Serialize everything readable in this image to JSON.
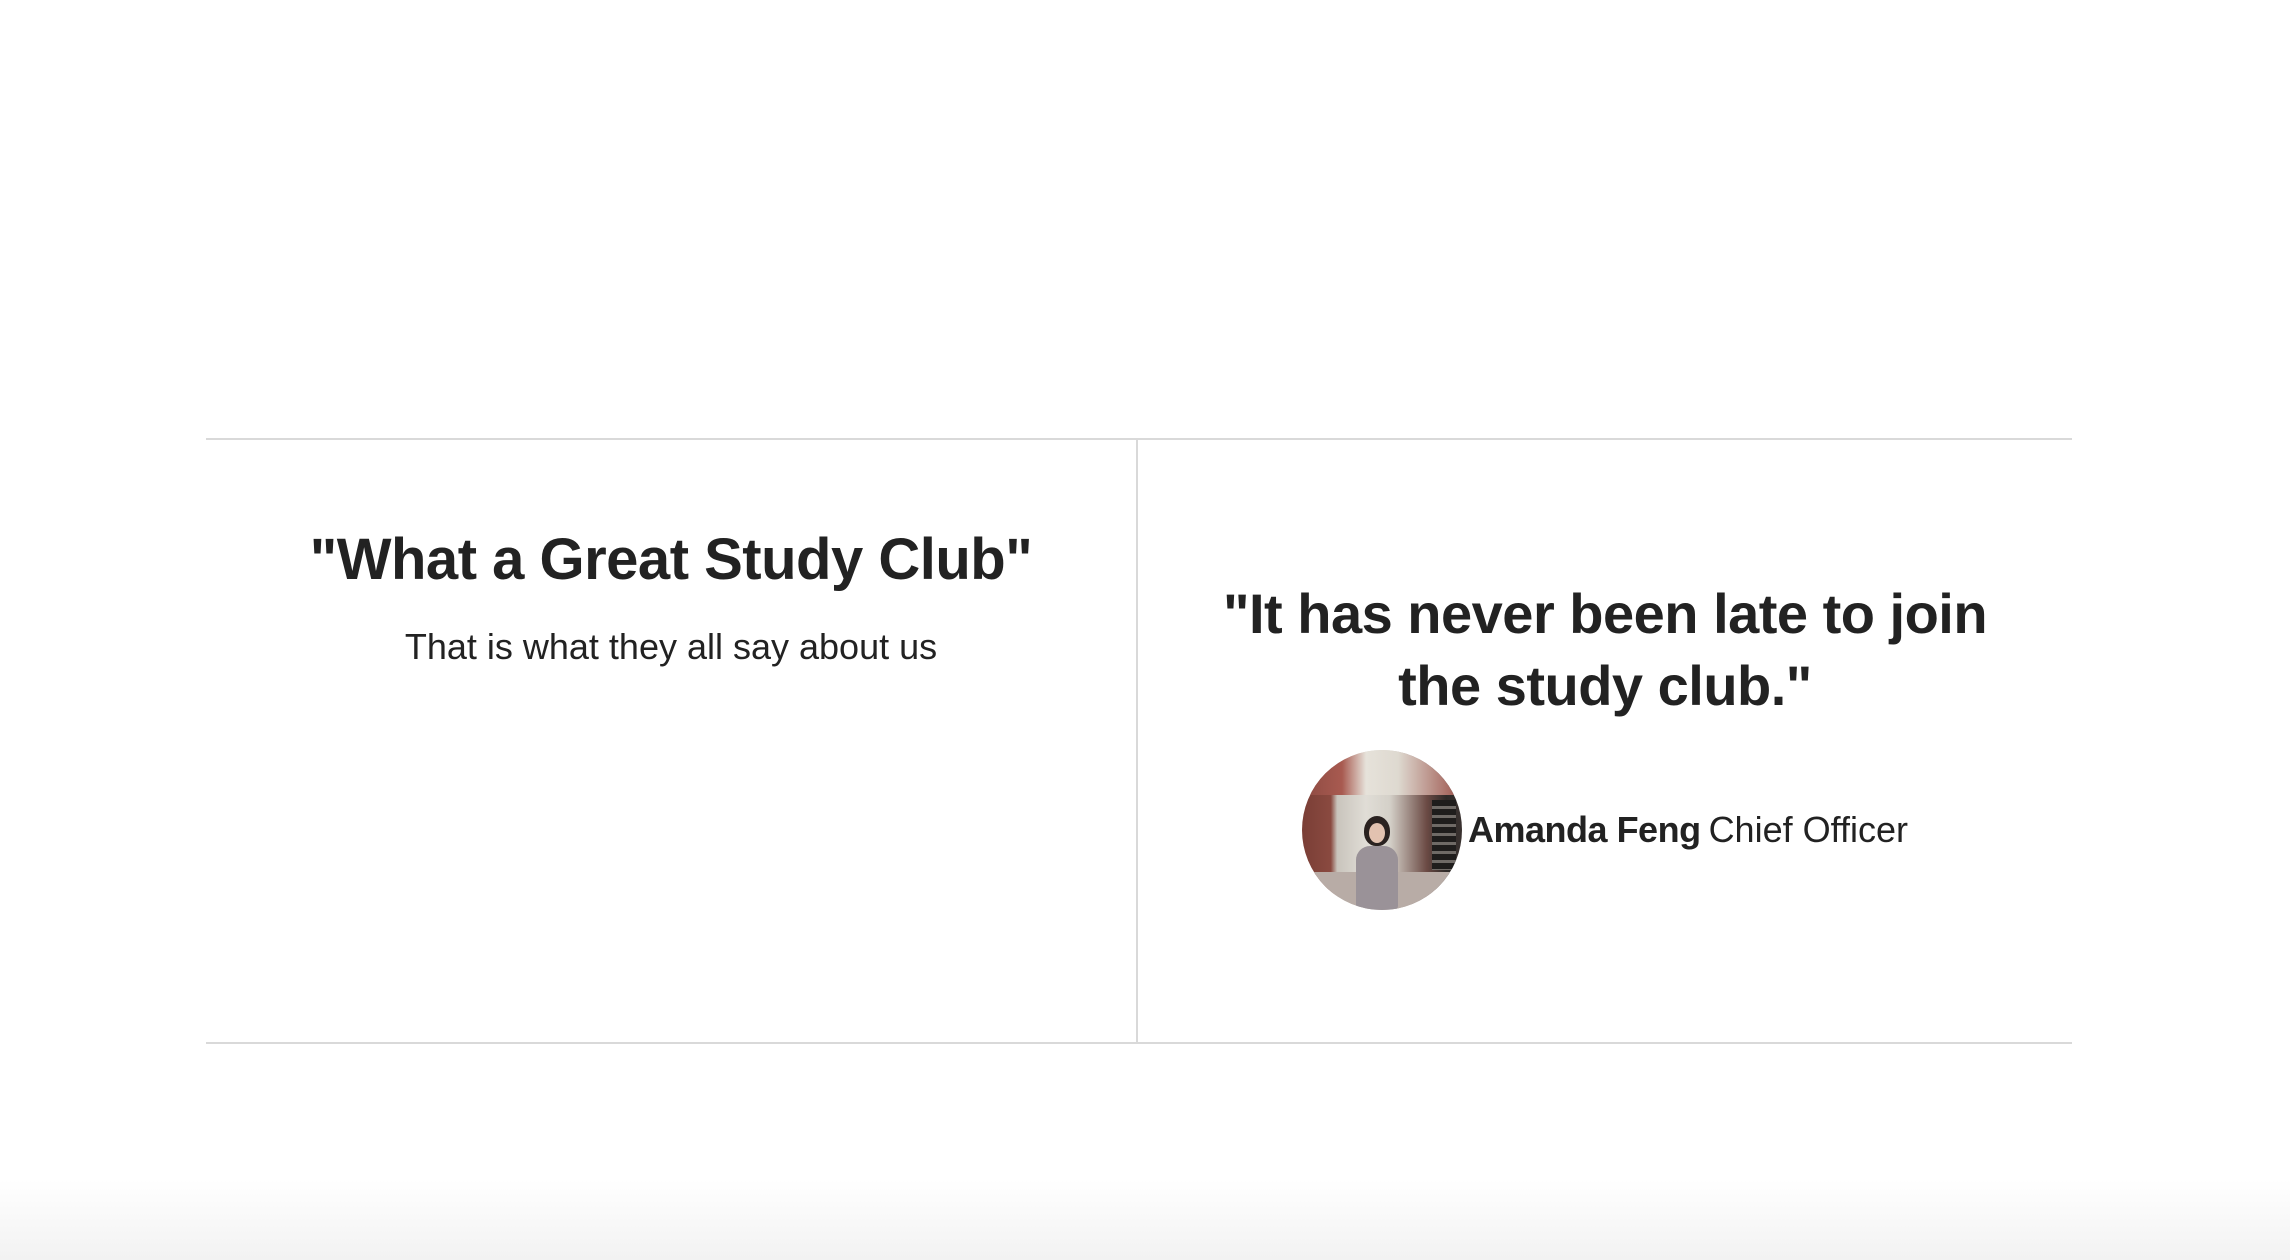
{
  "section": {
    "title": "\"What a Great Study Club\"",
    "subtitle": "That is what they all say about us"
  },
  "testimonial": {
    "quote": "\"It has never been late to join the study club.\"",
    "author_name": "Amanda Feng",
    "author_role": "Chief Officer",
    "avatar_icon": "person-photo"
  },
  "colors": {
    "text": "#222222",
    "divider": "#d9d9d9",
    "background": "#ffffff"
  }
}
